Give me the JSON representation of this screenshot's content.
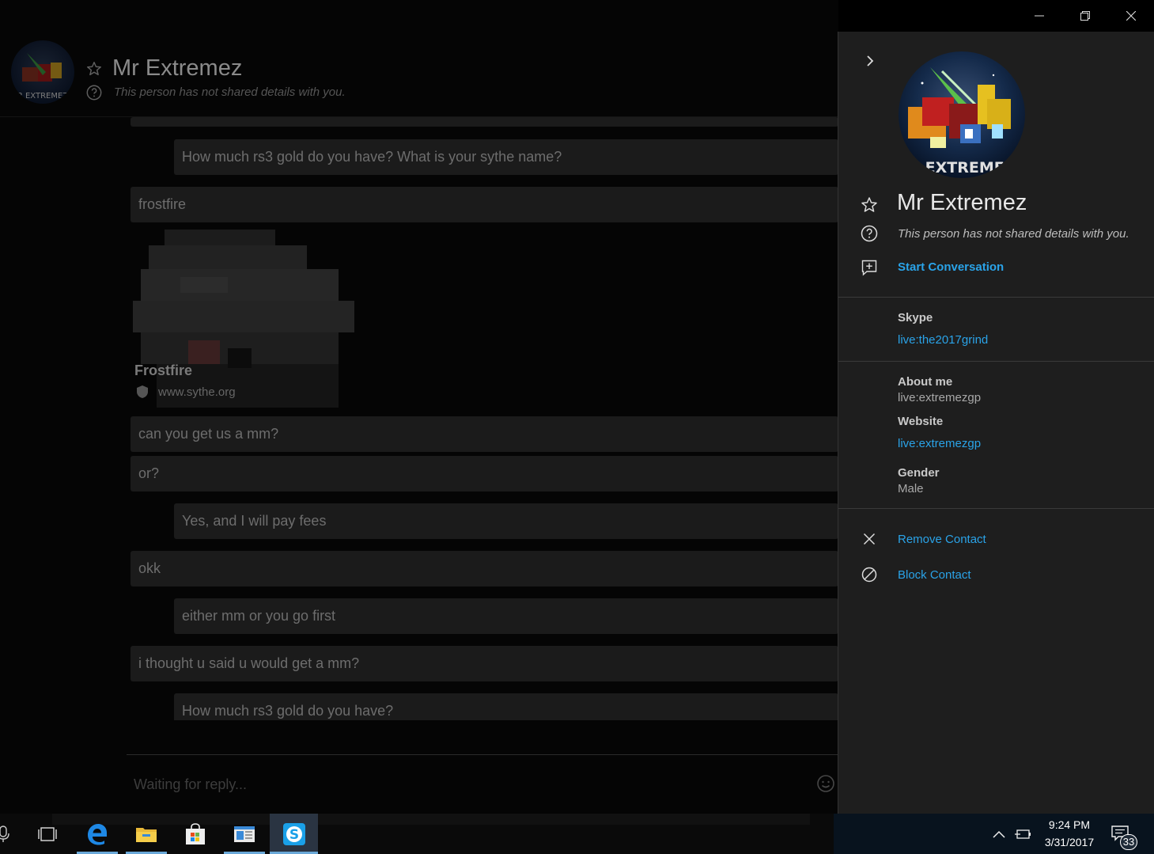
{
  "chat_header": {
    "name": "Mr Extremez",
    "status": "This person has not shared details with you."
  },
  "messages": [
    {
      "dir": "in",
      "text": "",
      "partial": true
    },
    {
      "dir": "out",
      "text": "How much rs3 gold do you have? What is your sythe name?"
    },
    {
      "dir": "in",
      "text": "frostfire"
    },
    {
      "dir": "in",
      "text": "can you get us a mm?"
    },
    {
      "dir": "in",
      "text": "or?"
    },
    {
      "dir": "out",
      "text": "Yes, and I will pay fees"
    },
    {
      "dir": "in",
      "text": "okk"
    },
    {
      "dir": "out",
      "text": "either mm or you go first"
    },
    {
      "dir": "in",
      "text": "i thought u said u would get a mm?"
    },
    {
      "dir": "out",
      "text": "How much rs3 gold do you have?"
    }
  ],
  "link_preview": {
    "title": "Frostfire",
    "url": "www.sythe.org"
  },
  "composer": {
    "placeholder": "Waiting for reply..."
  },
  "panel": {
    "name": "Mr Extremez",
    "avatar_text": "R EXTREMEZ",
    "status": "This person has not shared details with you.",
    "start_conversation": "Start Conversation",
    "skype_label": "Skype",
    "skype_id": "live:the2017grind",
    "about_label": "About me",
    "about_value": "live:extremezgp",
    "website_label": "Website",
    "website_value": "live:extremezgp",
    "gender_label": "Gender",
    "gender_value": "Male",
    "remove_contact": "Remove Contact",
    "block_contact": "Block Contact"
  },
  "taskbar": {
    "time": "9:24 PM",
    "date": "3/31/2017",
    "notifications": "33"
  },
  "colors": {
    "accent": "#2aa3e8",
    "panel_bg": "#1e1e1e",
    "bubble_bg": "#1b1b1b"
  }
}
